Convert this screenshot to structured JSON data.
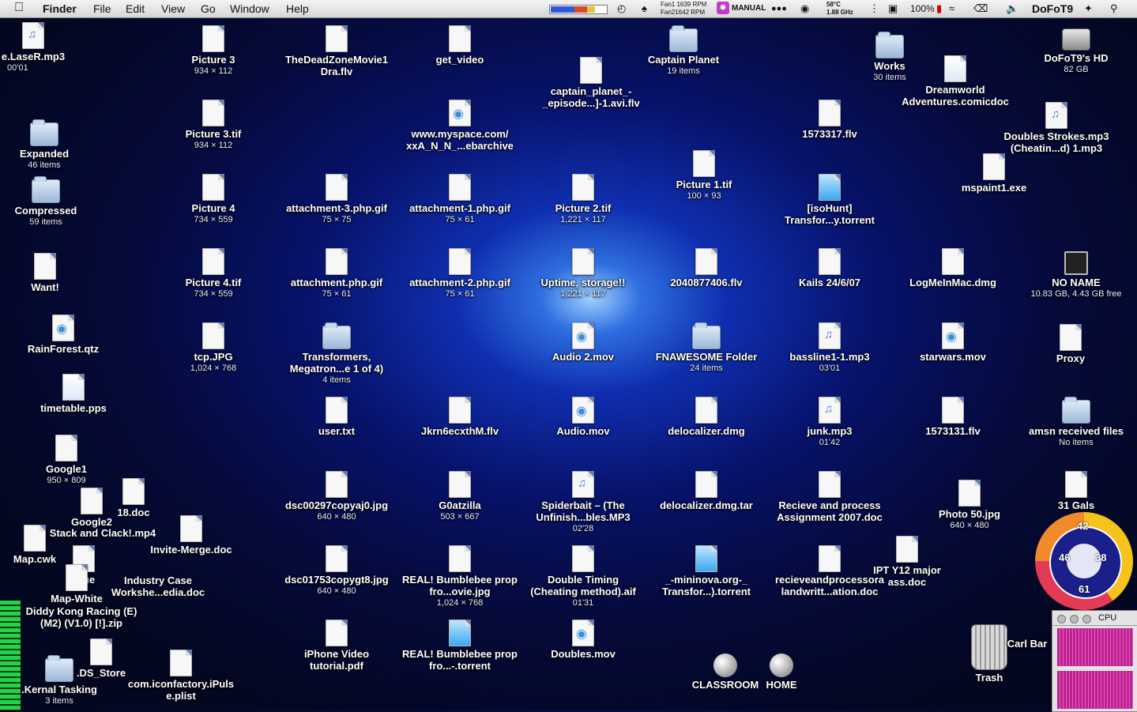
{
  "menubar": {
    "app": "Finder",
    "menus": [
      "File",
      "Edit",
      "View",
      "Go",
      "Window",
      "Help"
    ],
    "fan1": "Fan1 1639 RPM",
    "fan2": "Fan21642 RPM",
    "fan_mode": "MANUAL",
    "temp": "58°C",
    "cpu_speed": "1.88 GHz",
    "battery": "100%",
    "user": "DoFoT9"
  },
  "desktop": {
    "icons": [
      {
        "name": "e.LaseR.mp3",
        "info": "00'01",
        "kind": "music"
      },
      {
        "name": "Picture 3",
        "info": "934 × 112",
        "kind": "doc"
      },
      {
        "name": "TheDeadZoneMovie1 Dra.flv",
        "info": "",
        "kind": "doc"
      },
      {
        "name": "get_video",
        "info": "",
        "kind": "doc"
      },
      {
        "name": "captain_planet_-_episode...]-1.avi.flv",
        "info": "",
        "kind": "doc"
      },
      {
        "name": "Captain Planet",
        "info": "19 items",
        "kind": "folder"
      },
      {
        "name": "Works",
        "info": "30 items",
        "kind": "folder"
      },
      {
        "name": "Dreamworld Adventures.comicdoc",
        "info": "",
        "kind": "doc"
      },
      {
        "name": "DoFoT9's HD",
        "info": "82 GB",
        "kind": "disk"
      },
      {
        "name": "Picture 3.tif",
        "info": "934 × 112",
        "kind": "doc"
      },
      {
        "name": "Expanded",
        "info": "46 items",
        "kind": "folder"
      },
      {
        "name": "www.myspace.com/ xxA_N_N_...ebarchive",
        "info": "",
        "kind": "doc"
      },
      {
        "name": "1573317.flv",
        "info": "",
        "kind": "doc"
      },
      {
        "name": "Doubles Strokes.mp3 (Cheatin...d) 1.mp3",
        "info": "",
        "kind": "music"
      },
      {
        "name": "Compressed",
        "info": "59 items",
        "kind": "folder"
      },
      {
        "name": "Picture 4",
        "info": "734 × 559",
        "kind": "doc"
      },
      {
        "name": "attachment-3.php.gif",
        "info": "75 × 75",
        "kind": "doc"
      },
      {
        "name": "attachment-1.php.gif",
        "info": "75 × 61",
        "kind": "doc"
      },
      {
        "name": "Picture 2.tif",
        "info": "1,221 × 117",
        "kind": "doc"
      },
      {
        "name": "Picture 1.tif",
        "info": "100 × 93",
        "kind": "doc"
      },
      {
        "name": "[isoHunt] Transfor...y.torrent",
        "info": "",
        "kind": "tor"
      },
      {
        "name": "mspaint1.exe",
        "info": "",
        "kind": "doc"
      },
      {
        "name": "Want!",
        "info": "",
        "kind": "doc"
      },
      {
        "name": "Picture 4.tif",
        "info": "734 × 559",
        "kind": "doc"
      },
      {
        "name": "attachment.php.gif",
        "info": "75 × 61",
        "kind": "doc"
      },
      {
        "name": "attachment-2.php.gif",
        "info": "75 × 61",
        "kind": "doc"
      },
      {
        "name": "Uptime, storage!!",
        "info": "1,221 × 117",
        "kind": "doc"
      },
      {
        "name": "2040877406.flv",
        "info": "",
        "kind": "doc"
      },
      {
        "name": "Kails 24/6/07",
        "info": "",
        "kind": "doc"
      },
      {
        "name": "LogMeInMac.dmg",
        "info": "",
        "kind": "doc"
      },
      {
        "name": "NO NAME",
        "info": "10.83 GB, 4.43 GB free",
        "kind": "drive"
      },
      {
        "name": "RainForest.qtz",
        "info": "",
        "kind": "qt"
      },
      {
        "name": "tcp.JPG",
        "info": "1,024 × 768",
        "kind": "doc"
      },
      {
        "name": "Transformers, Megatron...e 1 of 4)",
        "info": "4 items",
        "kind": "folder"
      },
      {
        "name": "Audio 2.mov",
        "info": "",
        "kind": "qt"
      },
      {
        "name": "FNAWESOME Folder",
        "info": "24 items",
        "kind": "folder"
      },
      {
        "name": "bassline1-1.mp3",
        "info": "03'01",
        "kind": "music"
      },
      {
        "name": "starwars.mov",
        "info": "",
        "kind": "qt"
      },
      {
        "name": "Proxy",
        "info": "",
        "kind": "doc"
      },
      {
        "name": "timetable.pps",
        "info": "",
        "kind": "doc"
      },
      {
        "name": "user.txt",
        "info": "",
        "kind": "doc"
      },
      {
        "name": "Jkrn6ecxthM.flv",
        "info": "",
        "kind": "doc"
      },
      {
        "name": "Audio.mov",
        "info": "",
        "kind": "qt"
      },
      {
        "name": "delocalizer.dmg",
        "info": "",
        "kind": "doc"
      },
      {
        "name": "junk.mp3",
        "info": "01'42",
        "kind": "music"
      },
      {
        "name": "1573131.flv",
        "info": "",
        "kind": "doc"
      },
      {
        "name": "amsn received files",
        "info": "No items",
        "kind": "folder"
      },
      {
        "name": "Google1",
        "info": "950 × 809",
        "kind": "doc"
      },
      {
        "name": "18.doc",
        "info": "",
        "kind": "doc"
      },
      {
        "name": "Google2",
        "info": "",
        "kind": "doc"
      },
      {
        "name": "Stack and Clack!.mp4",
        "info": "",
        "kind": "doc"
      },
      {
        "name": "dsc00297copyaj0.jpg",
        "info": "640 × 480",
        "kind": "doc"
      },
      {
        "name": "G0atzilla",
        "info": "503 × 667",
        "kind": "doc"
      },
      {
        "name": "Spiderbait – (The Unfinish...bles.MP3",
        "info": "02'28",
        "kind": "music"
      },
      {
        "name": "delocalizer.dmg.tar",
        "info": "",
        "kind": "doc"
      },
      {
        "name": "Recieve and process Assignment 2007.doc",
        "info": "",
        "kind": "doc"
      },
      {
        "name": "Photo 50.jpg",
        "info": "640 × 480",
        "kind": "doc"
      },
      {
        "name": "31 Gals",
        "info": "",
        "kind": "doc"
      },
      {
        "name": "Map.cwk",
        "info": "",
        "kind": "doc"
      },
      {
        "name": "Invite-Merge.doc",
        "info": "",
        "kind": "doc"
      },
      {
        "name": "Blue",
        "info": "",
        "kind": "doc"
      },
      {
        "name": "Industry Case Workshe...edia.doc",
        "info": "",
        "kind": "doc"
      },
      {
        "name": "dsc01753copygt8.jpg",
        "info": "640 × 480",
        "kind": "doc"
      },
      {
        "name": "REAL! Bumblebee prop fro...ovie.jpg",
        "info": "1,024 × 768",
        "kind": "doc"
      },
      {
        "name": "Double Timing (Cheating method).aif",
        "info": "01'31",
        "kind": "doc"
      },
      {
        "name": "_-mininova.org-_ Transfor...).torrent",
        "info": "",
        "kind": "tor"
      },
      {
        "name": "recieveandprocessora landwritt...ation.doc",
        "info": "",
        "kind": "doc"
      },
      {
        "name": "IPT Y12 major ass.doc",
        "info": "",
        "kind": "doc"
      },
      {
        "name": "Map-White",
        "info": "",
        "kind": "doc"
      },
      {
        "name": "Diddy Kong Racing (E) (M2) (V1.0) [!].zip",
        "info": "",
        "kind": "doc"
      },
      {
        "name": "iPhone Video tutorial.pdf",
        "info": "",
        "kind": "doc"
      },
      {
        "name": "REAL! Bumblebee prop fro...-.torrent",
        "info": "",
        "kind": "tor"
      },
      {
        "name": "Doubles.mov",
        "info": "",
        "kind": "qt"
      },
      {
        "name": ".DS_Store",
        "info": "",
        "kind": "doc"
      },
      {
        "name": ".Kernal Tasking",
        "info": "3 items",
        "kind": "folder"
      },
      {
        "name": "com.iconfactory.iPuls e.plist",
        "info": "",
        "kind": "doc"
      },
      {
        "name": "CLASSROOM",
        "info": "",
        "kind": "globe"
      },
      {
        "name": "HOME",
        "info": "",
        "kind": "globe"
      },
      {
        "name": "Trash",
        "info": "",
        "kind": "trash"
      },
      {
        "name": "Carl Bar",
        "info": "",
        "kind": "doc"
      }
    ]
  },
  "gauge": {
    "top": "42",
    "left": "46",
    "right": "38",
    "bottom": "61"
  },
  "cpu_widget": {
    "title": "CPU"
  }
}
